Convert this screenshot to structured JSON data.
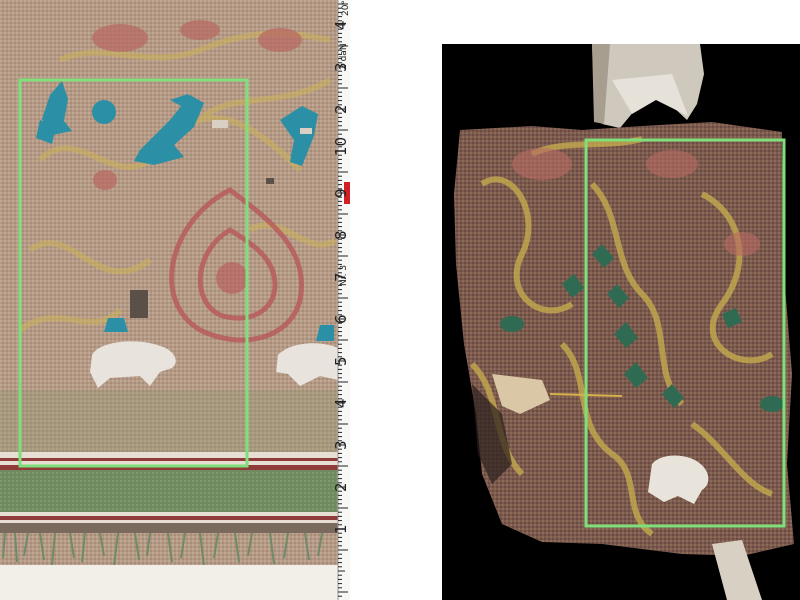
{
  "left_image": {
    "label": "woven silk fragment with ruler (left)",
    "highlight_color": "#7ee07a",
    "ruler": {
      "top_label": "20°C",
      "unit_label": "2 daN",
      "brand": "Nr. 3",
      "numbers": [
        "4",
        "3",
        "2",
        "10",
        "9",
        "8",
        "7",
        "6",
        "5",
        "4",
        "3",
        "2",
        "1"
      ]
    }
  },
  "right_image": {
    "label": "silk fragment on black background (right)",
    "highlight_color": "#7ee07a"
  }
}
